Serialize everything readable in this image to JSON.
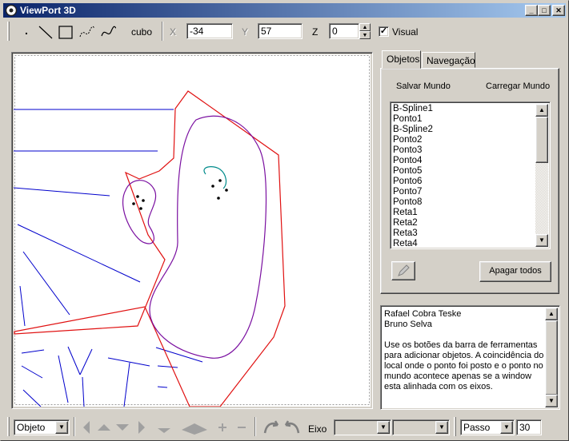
{
  "window": {
    "title": "ViewPort 3D"
  },
  "toolbar": {
    "point_tool": ".",
    "cube_label": "cubo",
    "x_label": "X",
    "x_value": "-34",
    "y_label": "Y",
    "y_value": "57",
    "z_label": "Z",
    "z_value": "0",
    "visual_label": "Visual",
    "visual_checked": "✓"
  },
  "tabs": {
    "objects": "Objetos",
    "navigation": "Navegação"
  },
  "panel": {
    "save_label": "Salvar Mundo",
    "load_label": "Carregar Mundo",
    "delete_all_label": "Apagar todos",
    "objects": [
      "B-Spline1",
      "Ponto1",
      "B-Spline2",
      "Ponto2",
      "Ponto3",
      "Ponto4",
      "Ponto5",
      "Ponto6",
      "Ponto7",
      "Ponto8",
      "Reta1",
      "Reta2",
      "Reta3",
      "Reta4"
    ]
  },
  "info_text": "Rafael Cobra Teske\nBruno Selva\n\nUse os botões da barra de ferramentas para adicionar objetos. A coincidência do local onde o ponto foi posto e o ponto no mundo acontece apenas se a window esta alinhada com os eixos.",
  "statusbar": {
    "mode_value": "Objeto",
    "axis_label": "Eixo",
    "step_value": "Passo",
    "step_amount": "30"
  },
  "colors": {
    "titlebar": "#0a246a",
    "polygon": "#e01010",
    "spline": "#7a0fa0",
    "lines": "#0000cc",
    "curve": "#008b8b"
  }
}
